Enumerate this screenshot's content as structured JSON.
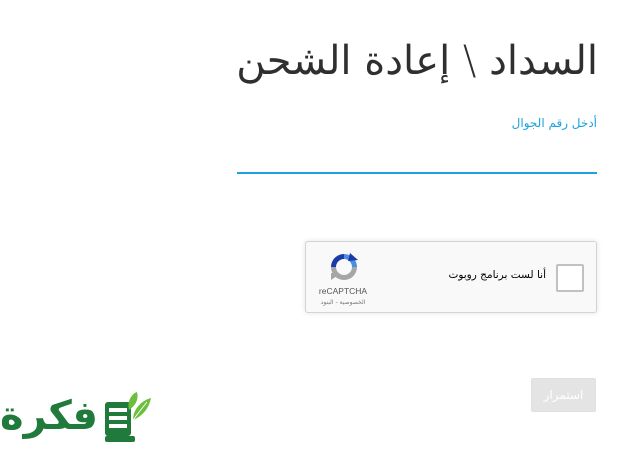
{
  "page": {
    "title": "السداد \\ إعادة الشحن"
  },
  "form": {
    "phone_label": "أدخل رقم الجوال",
    "phone_value": "",
    "continue_label": "استمرار"
  },
  "recaptcha": {
    "checkbox_label": "أنا لست برنامج روبوت",
    "brand": "reCAPTCHA",
    "links": "الخصوصية - البنود"
  },
  "logo": {
    "text": "فكرة"
  },
  "colors": {
    "accent": "#1aa3dd",
    "title": "#2f2f2f",
    "button_disabled": "#e4e4e4",
    "logo_green": "#1f7a3c"
  }
}
